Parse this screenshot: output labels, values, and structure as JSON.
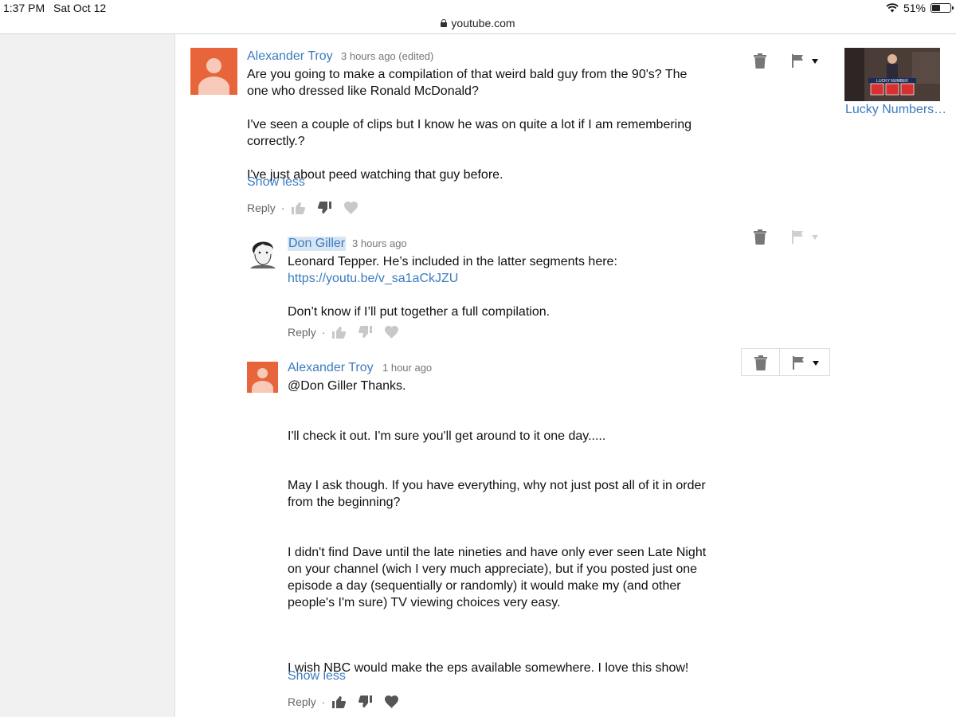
{
  "status": {
    "time": "1:37 PM",
    "date": "Sat Oct 12",
    "battery": "51%",
    "battery_level": 0.51
  },
  "url": "youtube.com",
  "colors": {
    "link": "#3b7bbf",
    "avatar": "#e8643a",
    "left_pane": "#f1f1f1"
  },
  "comments": [
    {
      "author": "Alexander Troy",
      "time": "3 hours ago (edited)",
      "lines": [
        "Are you going to make a compilation of that weird bald guy from the 90's? The",
        "one who dressed like Ronald McDonald?",
        "",
        "I've seen a couple of clips but I know he was on quite a lot if I am remembering",
        "correctly.?",
        "",
        "I've just about peed watching that guy before."
      ],
      "show_less": "Show less",
      "reply": "Reply"
    },
    {
      "author": "Don Giller",
      "time": "3 hours ago",
      "line1": "Leonard Tepper. He’s included in the latter segments here:",
      "link": "https://youtu.be/v_sa1aCkJZU",
      "line3": "Don’t know if I’ll put together a full compilation.",
      "reply": "Reply"
    },
    {
      "author": "Alexander Troy",
      "time": "1 hour ago",
      "lines": [
        "@Don Giller Thanks.",
        "I'll check it out. I'm sure you'll get around to it one day.....",
        "May I ask though. If you have everything, why not just post all of it in order",
        "from the beginning?",
        "I didn't find Dave until the late nineties and have only ever seen Late Night",
        "on your channel (wich I very much appreciate), but if you posted just one",
        "episode a day (sequentially or randomly) it would make my (and other",
        "people's I'm sure) TV viewing choices very easy.",
        "I wish NBC would make the eps available somewhere. I love this show!"
      ],
      "show_less": "Show less",
      "reply": "Reply"
    }
  ],
  "related": {
    "title": "Lucky Numbers…",
    "thumb_text": "LUCKY NUMBER"
  }
}
